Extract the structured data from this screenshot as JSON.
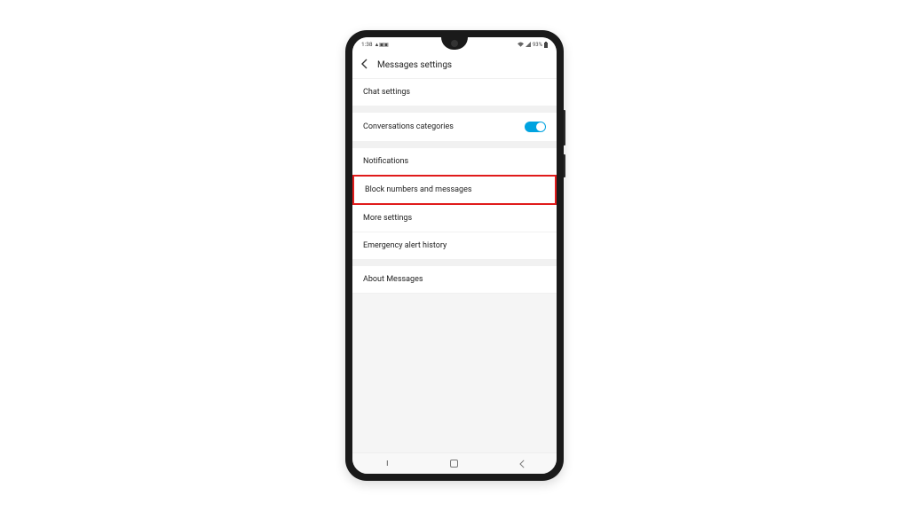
{
  "status": {
    "time": "1:38",
    "left_icons": "▲▣▣",
    "wifi": "�훈",
    "signal": "▲",
    "battery_pct": "93%",
    "battery_icon": "▮"
  },
  "header": {
    "title": "Messages settings"
  },
  "rows": {
    "chat": "Chat settings",
    "conv": "Conversations categories",
    "notif": "Notifications",
    "block": "Block numbers and messages",
    "more": "More settings",
    "alert": "Emergency alert history",
    "about": "About Messages"
  }
}
